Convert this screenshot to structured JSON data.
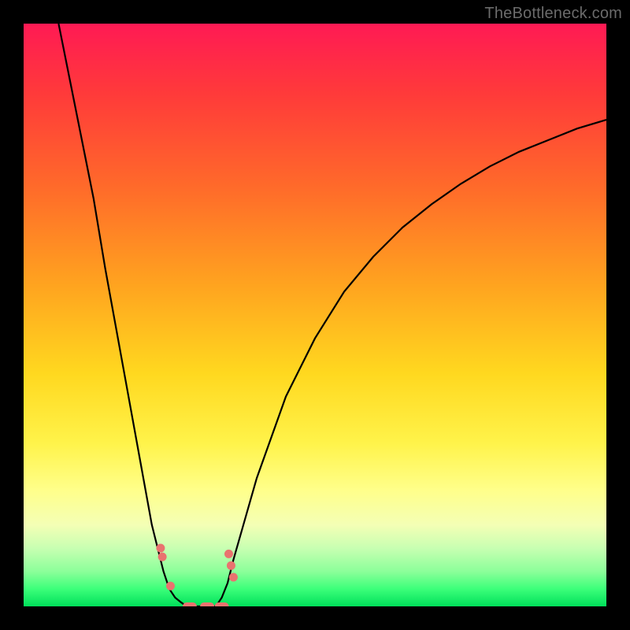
{
  "watermark": "TheBottleneck.com",
  "colors": {
    "gradient_top": "#ff1a54",
    "gradient_mid": "#ffd81f",
    "gradient_bottom": "#00e05a",
    "curve": "#000000",
    "marker": "#e9736f",
    "frame": "#000000"
  },
  "chart_data": {
    "type": "line",
    "title": "",
    "xlabel": "",
    "ylabel": "",
    "xlim": [
      0,
      100
    ],
    "ylim": [
      0,
      100
    ],
    "grid": false,
    "legend": false,
    "series": [
      {
        "name": "left-curve",
        "x": [
          6,
          8,
          10,
          12,
          14,
          16,
          18,
          20,
          22,
          23,
          24,
          25,
          26,
          27,
          28
        ],
        "values": [
          100,
          90,
          80,
          70,
          58,
          47,
          36,
          25,
          14,
          10,
          6,
          3,
          1.5,
          0.7,
          0
        ]
      },
      {
        "name": "right-curve",
        "x": [
          33,
          34,
          35,
          36,
          38,
          40,
          45,
          50,
          55,
          60,
          65,
          70,
          75,
          80,
          85,
          90,
          95,
          100
        ],
        "values": [
          0,
          1.5,
          4,
          8,
          15,
          22,
          36,
          46,
          54,
          60,
          65,
          69,
          72.5,
          75.5,
          78,
          80,
          82,
          83.5
        ]
      }
    ],
    "floor": {
      "x_start": 28,
      "x_end": 33,
      "value": 0
    },
    "markers": [
      {
        "x": 23.5,
        "y": 10,
        "shape": "circle"
      },
      {
        "x": 23.8,
        "y": 8.5,
        "shape": "circle"
      },
      {
        "x": 25.2,
        "y": 3.5,
        "shape": "circle"
      },
      {
        "x": 35.2,
        "y": 9,
        "shape": "circle"
      },
      {
        "x": 35.6,
        "y": 7,
        "shape": "circle"
      },
      {
        "x": 36.0,
        "y": 5,
        "shape": "circle"
      },
      {
        "x": 28.5,
        "y": 0,
        "shape": "capsule"
      },
      {
        "x": 31.5,
        "y": 0,
        "shape": "capsule"
      },
      {
        "x": 34.0,
        "y": 0,
        "shape": "capsule"
      }
    ]
  }
}
